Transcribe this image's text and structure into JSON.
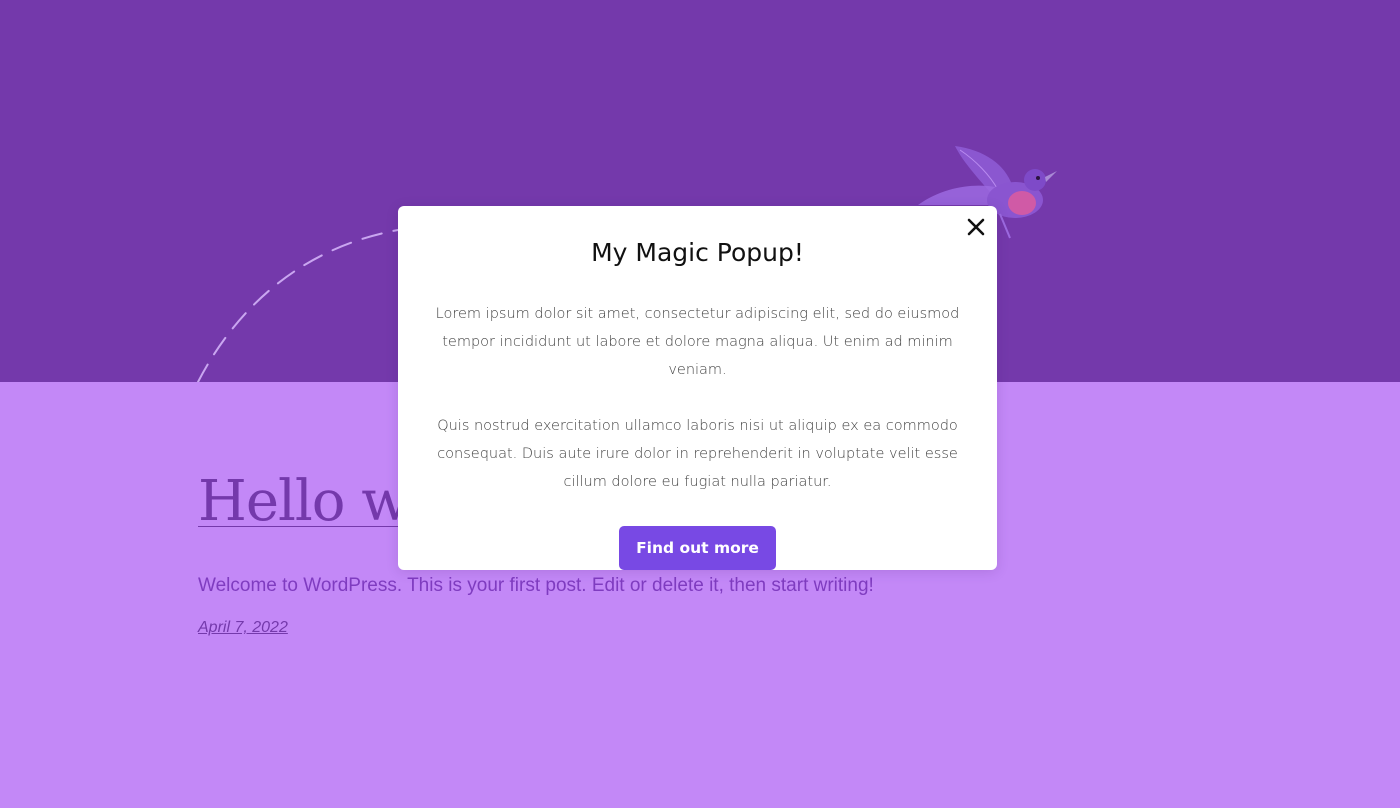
{
  "colors": {
    "hero_bg": "#7439ab",
    "page_bg": "#c388f7",
    "accent_text": "#7439ab",
    "button_bg": "#7849e4",
    "popup_bg": "#ffffff"
  },
  "post": {
    "title": "Hello world!",
    "excerpt": "Welcome to WordPress. This is your first post. Edit or delete it, then start writing!",
    "date": "April 7, 2022"
  },
  "popup": {
    "title": "My Magic Popup!",
    "paragraph1": "Lorem ipsum dolor sit amet, consectetur adipiscing elit, sed do eiusmod tempor incididunt ut labore et dolore magna aliqua. Ut enim ad minim veniam.",
    "paragraph2": "Quis nostrud exercitation ullamco laboris nisi ut aliquip ex ea commodo consequat. Duis aute irure dolor in reprehenderit in voluptate velit esse cillum dolore eu fugiat nulla pariatur.",
    "button_label": "Find out more",
    "close_icon": "close-icon"
  },
  "hero": {
    "decoration": "hummingbird-illustration"
  }
}
